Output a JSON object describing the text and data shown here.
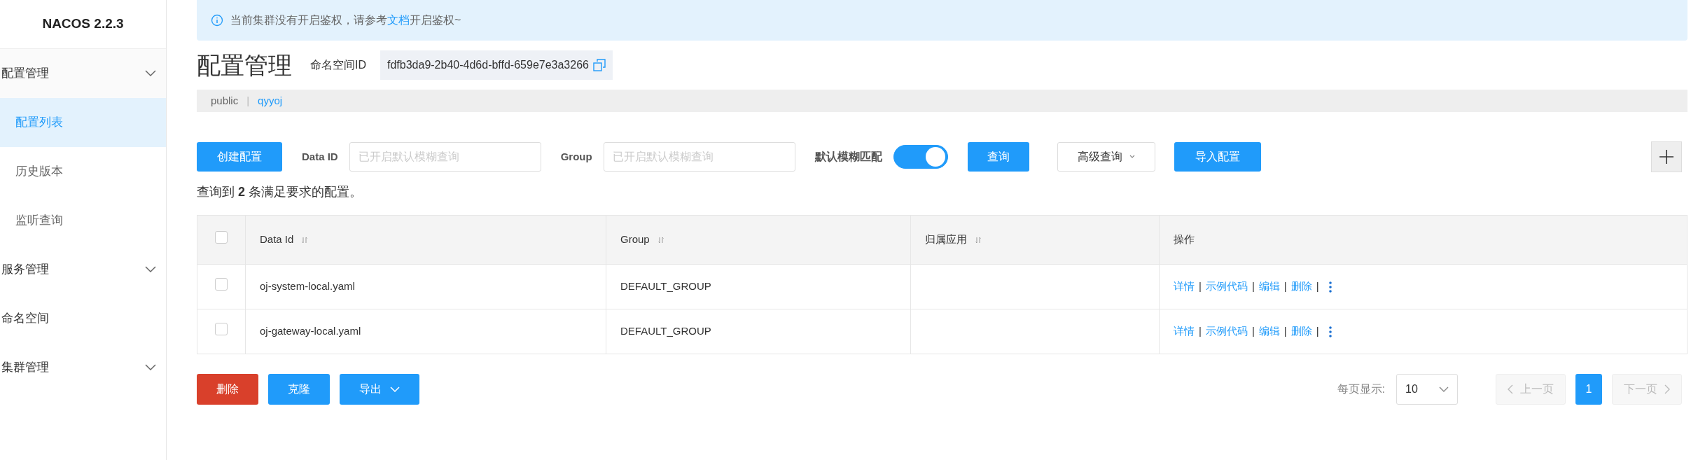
{
  "sidebar": {
    "title": "NACOS 2.2.3",
    "items": [
      {
        "label": "配置管理",
        "kind": "group",
        "expanded": true,
        "selected": false,
        "children": [
          {
            "label": "配置列表",
            "selected": true
          },
          {
            "label": "历史版本",
            "selected": false
          },
          {
            "label": "监听查询",
            "selected": false
          }
        ]
      },
      {
        "label": "服务管理",
        "kind": "group",
        "selected": false
      },
      {
        "label": "命名空间",
        "kind": "link",
        "selected": false
      },
      {
        "label": "集群管理",
        "kind": "group",
        "selected": false
      }
    ]
  },
  "notice": {
    "text": "当前集群没有开启鉴权，请参考",
    "link": "文档",
    "after": "开启鉴权~"
  },
  "header": {
    "title": "配置管理",
    "namespace_label": "命名空间ID",
    "namespace_id": "fdfb3da9-2b40-4d6d-bffd-659e7e3a3266"
  },
  "namespace_tabs": [
    {
      "label": "public",
      "selected": false
    },
    {
      "label": "qyyoj",
      "selected": true
    }
  ],
  "namespace_tab_separator": "|",
  "toolbar": {
    "create_button": "创建配置",
    "data_id_label": "Data ID",
    "data_id_placeholder": "已开启默认模糊查询",
    "group_label": "Group",
    "group_placeholder": "已开启默认模糊查询",
    "fuzzy_label": "默认模糊匹配",
    "fuzzy_on": true,
    "query_button": "查询",
    "advanced_button": "高级查询",
    "import_button": "导入配置"
  },
  "result_text": "查询到 **2** 条满足要求的配置。",
  "table": {
    "select_all_checked": false,
    "columns": [
      "Data Id",
      "Group",
      "归属应用",
      "操作"
    ],
    "rows": [
      {
        "checked": false,
        "data_id": "oj-system-local.yaml",
        "group": "DEFAULT_GROUP",
        "actions": [
          {
            "kind": "link",
            "label": "详情"
          },
          {
            "kind": "separator",
            "label": "|"
          },
          {
            "kind": "link",
            "label": "示例代码"
          },
          {
            "kind": "separator",
            "label": "|"
          },
          {
            "kind": "link",
            "label": "编辑"
          },
          {
            "kind": "separator",
            "label": "|"
          },
          {
            "kind": "link",
            "label": "删除"
          },
          {
            "kind": "separator",
            "label": "|"
          }
        ]
      },
      {
        "checked": false,
        "data_id": "oj-gateway-local.yaml",
        "group": "DEFAULT_GROUP",
        "actions": [
          {
            "kind": "link",
            "label": "详情"
          },
          {
            "kind": "separator",
            "label": "|"
          },
          {
            "kind": "link",
            "label": "示例代码"
          },
          {
            "kind": "separator",
            "label": "|"
          },
          {
            "kind": "link",
            "label": "编辑"
          },
          {
            "kind": "separator",
            "label": "|"
          },
          {
            "kind": "link",
            "label": "删除"
          },
          {
            "kind": "separator",
            "label": "|"
          }
        ]
      }
    ]
  },
  "bottom": {
    "delete_button": "删除",
    "clone_button": "克隆",
    "export_button": "导出",
    "page_size_label": "每页显示:",
    "page_size": "10",
    "prev": "上一页",
    "pages": [
      {
        "label": "1",
        "selected": true
      }
    ],
    "next": "下一页"
  }
}
